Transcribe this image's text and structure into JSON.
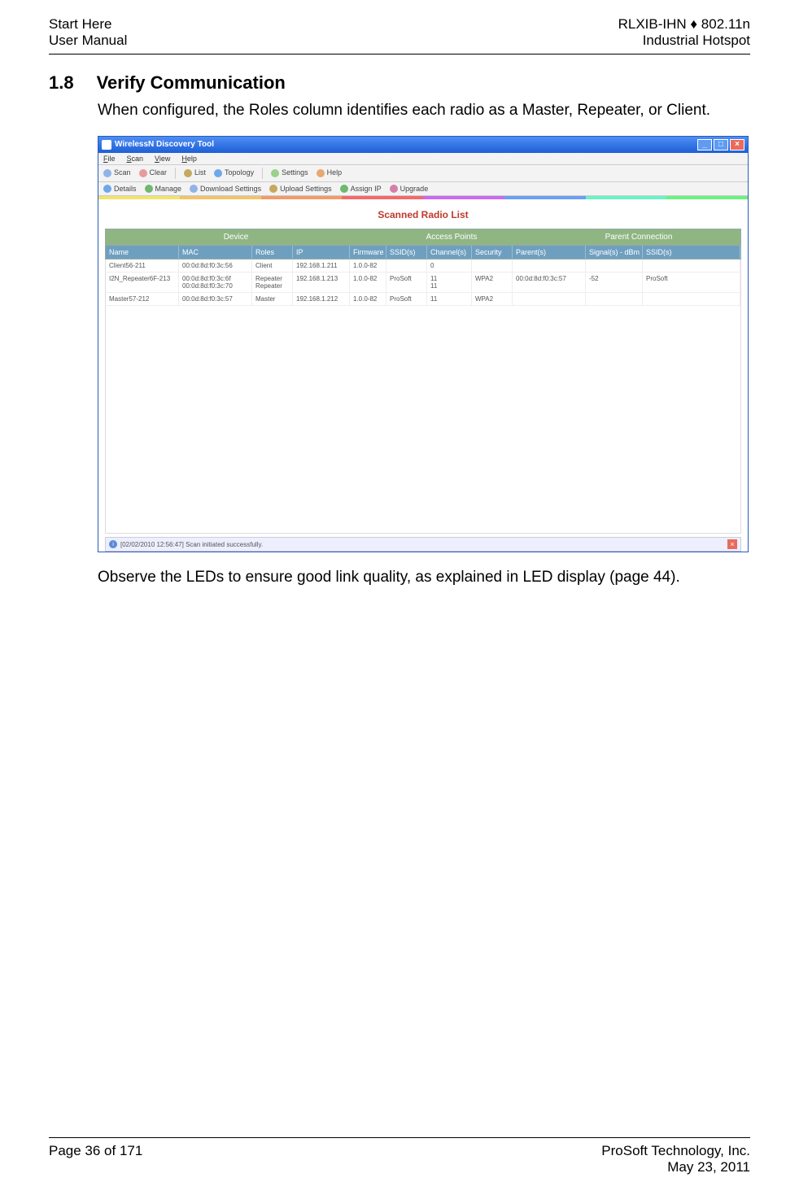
{
  "header": {
    "left_line1": "Start Here",
    "left_line2": "User Manual",
    "right_line1": "RLXIB-IHN ♦ 802.11n",
    "right_line2": "Industrial Hotspot"
  },
  "section": {
    "number": "1.8",
    "title": "Verify Communication"
  },
  "para1": "When configured, the Roles column identifies each radio as a Master, Repeater, or Client.",
  "para2": "Observe the LEDs to ensure good link quality, as explained in LED display (page 44).",
  "app": {
    "title": "WirelessN Discovery Tool",
    "menus": [
      "File",
      "Scan",
      "View",
      "Help"
    ],
    "toolbar1": [
      "Scan",
      "Clear",
      "List",
      "Topology",
      "Settings",
      "Help"
    ],
    "toolbar2": [
      "Details",
      "Manage",
      "Download Settings",
      "Upload Settings",
      "Assign IP",
      "Upgrade"
    ],
    "list_title": "Scanned Radio List",
    "groups": {
      "device": "Device",
      "ap": "Access Points",
      "parent": "Parent Connection"
    },
    "cols": {
      "name": "Name",
      "mac": "MAC",
      "roles": "Roles",
      "ip": "IP",
      "fw": "Firmware",
      "ssid": "SSID(s)",
      "ch": "Channel(s)",
      "sec": "Security",
      "par": "Parent(s)",
      "sig": "Signal(s) - dBm",
      "ssid2": "SSID(s)"
    },
    "rows": [
      {
        "name": "Client56-211",
        "mac": "00:0d:8d:f0:3c:56",
        "roles": "Client",
        "ip": "192.168.1.211",
        "fw": "1.0.0-82",
        "ssid": "",
        "ch": "0",
        "sec": "",
        "par": "",
        "sig": "",
        "ssid2": ""
      },
      {
        "name": "I2N_Repeater6F-213",
        "mac": "00:0d:8d:f0:3c:6f\n00:0d:8d:f0:3c:70",
        "roles": "Repeater\nRepeater",
        "ip": "192.168.1.213",
        "fw": "1.0.0-82",
        "ssid": "ProSoft",
        "ch": "11\n11",
        "sec": "WPA2",
        "par": "00:0d:8d:f0:3c:57",
        "sig": "-52",
        "ssid2": "ProSoft"
      },
      {
        "name": "Master57-212",
        "mac": "00:0d:8d:f0:3c:57",
        "roles": "Master",
        "ip": "192.168.1.212",
        "fw": "1.0.0-82",
        "ssid": "ProSoft",
        "ch": "11",
        "sec": "WPA2",
        "par": "",
        "sig": "",
        "ssid2": ""
      }
    ],
    "status": "[02/02/2010 12:56:47] Scan initiated successfully."
  },
  "footer": {
    "left": "Page 36 of 171",
    "right_line1": "ProSoft Technology, Inc.",
    "right_line2": "May 23, 2011"
  }
}
